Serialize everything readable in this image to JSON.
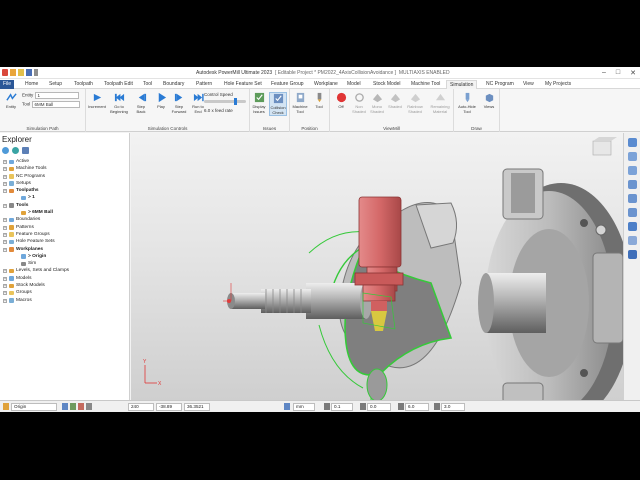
{
  "window": {
    "title": "Autodesk PowerMill Ultimate 2023",
    "project": "[ Editable Project * PM2022_4AxisCollisionAvoidance ]",
    "mode": "MULTIAXIS ENABLED",
    "controls": [
      "–",
      "□",
      "✕"
    ]
  },
  "tabs": [
    "File",
    "Home",
    "Setup",
    "Toolpath",
    "Toolpath Edit",
    "Tool",
    "Boundary",
    "Pattern",
    "Hole Feature Set",
    "Feature Group",
    "Workplane",
    "Model",
    "Stock Model",
    "Machine Tool",
    "Simulation",
    "NC Program",
    "View",
    "My Projects"
  ],
  "active_tab": "Simulation",
  "ribbon": {
    "simulation_path": {
      "label": "Simulation Path",
      "entity_button": "Entity",
      "entity_label": "Entity",
      "entity_value": "1",
      "tool_label": "Tool",
      "tool_value": "6MM Ball"
    },
    "simulation_controls": {
      "label": "Simulation Controls",
      "buttons": [
        "Increment",
        "Go to Beginning",
        "Step Back",
        "Play",
        "Step Forward",
        "Run to End"
      ],
      "speed_label": "Control Speed",
      "feed_rate": "6.0 x feed rate"
    },
    "issues": {
      "label": "Issues",
      "buttons": [
        "Display Issues",
        "Collision Check"
      ]
    },
    "position": {
      "label": "Position",
      "buttons": [
        "Machine Tool",
        "Tool"
      ]
    },
    "viewmill": {
      "label": "ViewMill",
      "buttons": [
        "Off",
        "Non Shaded",
        "Mono Shaded",
        "Shaded",
        "Rainbow Shaded",
        "Remaining Material"
      ]
    },
    "draw": {
      "label": "Draw",
      "buttons": [
        "Auto-Hide Tool",
        "Views"
      ]
    }
  },
  "explorer": {
    "title": "Explorer",
    "items": [
      {
        "label": "Active",
        "indent": 0,
        "bold": false
      },
      {
        "label": "Machine Tools",
        "indent": 0,
        "bold": false
      },
      {
        "label": "NC Programs",
        "indent": 0,
        "bold": false
      },
      {
        "label": "Setups",
        "indent": 0,
        "bold": false
      },
      {
        "label": "Toolpaths",
        "indent": 0,
        "bold": true
      },
      {
        "label": "> 1",
        "indent": 1,
        "bold": true
      },
      {
        "label": "Tools",
        "indent": 0,
        "bold": true
      },
      {
        "label": "> 6MM Ball",
        "indent": 1,
        "bold": true
      },
      {
        "label": "Boundaries",
        "indent": 0,
        "bold": false
      },
      {
        "label": "Patterns",
        "indent": 0,
        "bold": false
      },
      {
        "label": "Feature Groups",
        "indent": 0,
        "bold": false
      },
      {
        "label": "Hole Feature Sets",
        "indent": 0,
        "bold": false
      },
      {
        "label": "Workplanes",
        "indent": 0,
        "bold": true
      },
      {
        "label": "> Origin",
        "indent": 1,
        "bold": true
      },
      {
        "label": "Sim",
        "indent": 1,
        "bold": false
      },
      {
        "label": "Levels, Sets and Clamps",
        "indent": 0,
        "bold": false
      },
      {
        "label": "Models",
        "indent": 0,
        "bold": false
      },
      {
        "label": "Stock Models",
        "indent": 0,
        "bold": false
      },
      {
        "label": "Groups",
        "indent": 0,
        "bold": false
      },
      {
        "label": "Macros",
        "indent": 0,
        "bold": false
      }
    ]
  },
  "statusbar": {
    "workplane": "Origin",
    "x": "240",
    "y": "-38.89",
    "z": "36.3521",
    "units": "mm",
    "tolerance": "0.1",
    "thickness": "0.0",
    "diameter": "6.0",
    "stepover": "3.0"
  },
  "colors": {
    "accent": "#2b5797",
    "tool_holder": "#d46868",
    "toolpath_green": "#36c93a"
  }
}
